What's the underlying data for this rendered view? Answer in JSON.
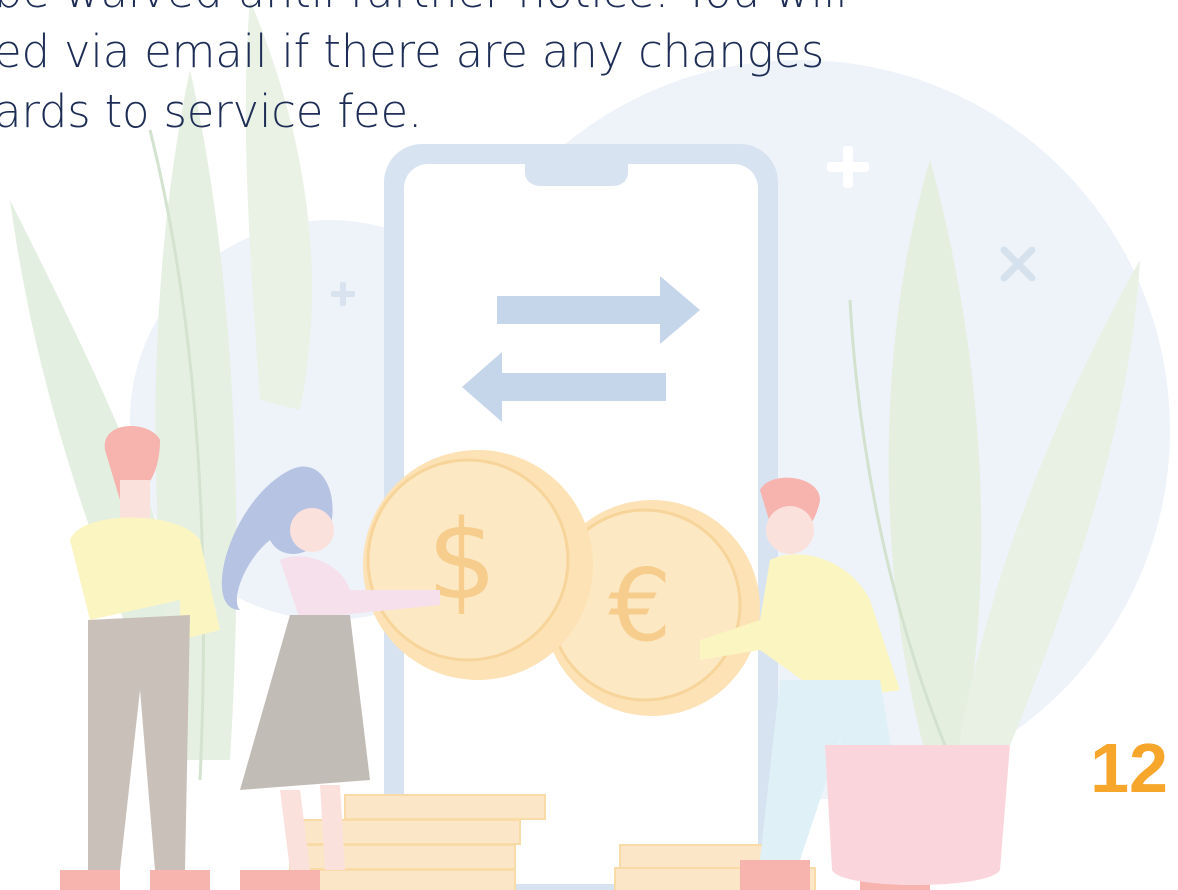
{
  "document": {
    "body_lines": [
      "be waived until further notice. You will",
      "ed via email if there are any changes",
      "ards to service fee."
    ],
    "page_number": "12"
  },
  "colors": {
    "text": "#1d2d56",
    "page_number": "#f6a62a",
    "phone_frame": "#d8e3f1",
    "arrows": "#c6d6ea",
    "coins": "#fbe3b8",
    "leaves": "#e4eedf",
    "background_circle": "#eef3f9"
  },
  "icons": [
    "plus-icon",
    "cross-icon",
    "dollar-icon",
    "euro-icon",
    "arrow-right-icon",
    "arrow-left-icon"
  ]
}
